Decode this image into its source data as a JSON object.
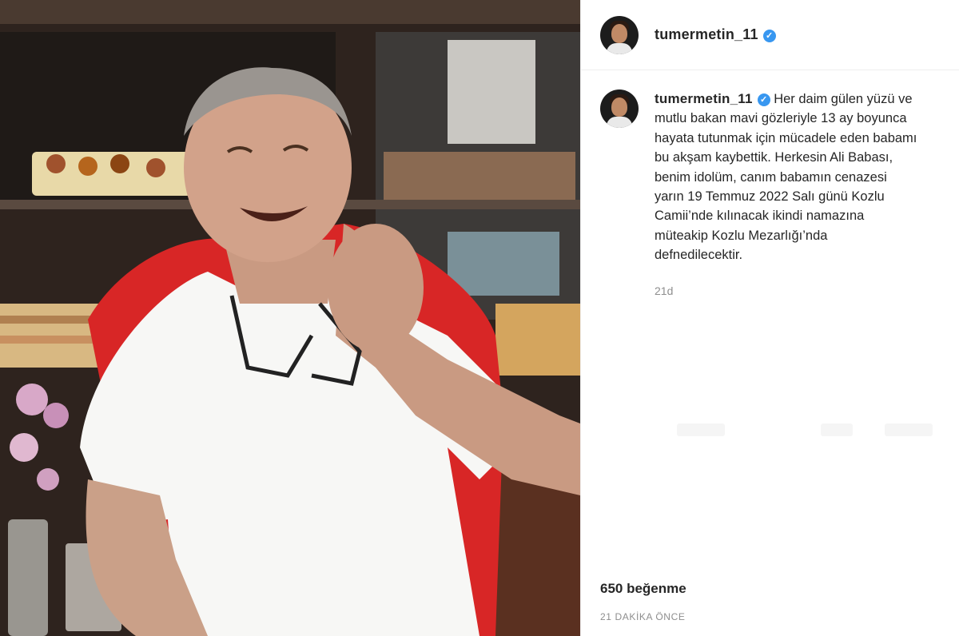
{
  "post": {
    "username": "tumermetin_11",
    "verified_icon": "verified-badge-icon",
    "caption": "Her daim gülen yüzü ve mutlu bakan mavi gözleriyle 13 ay boyunca hayata tutunmak için mücadele eden babamı bu akşam kaybettik. Herkesin Ali Babası, benim idolüm, canım babamın cenazesi yarın 19 Temmuz 2022 Salı günü Kozlu Camii’nde kılınacak ikindi namazına müteakip Kozlu Mezarlığı’nda defnedilecektir.",
    "caption_age": "21d",
    "likes": "650 beğenme",
    "timestamp": "21 DAKİKA ÖNCE"
  },
  "colors": {
    "verified": "#3897f0",
    "text": "#262626",
    "muted": "#8e8e8e",
    "divider": "#efefef"
  }
}
